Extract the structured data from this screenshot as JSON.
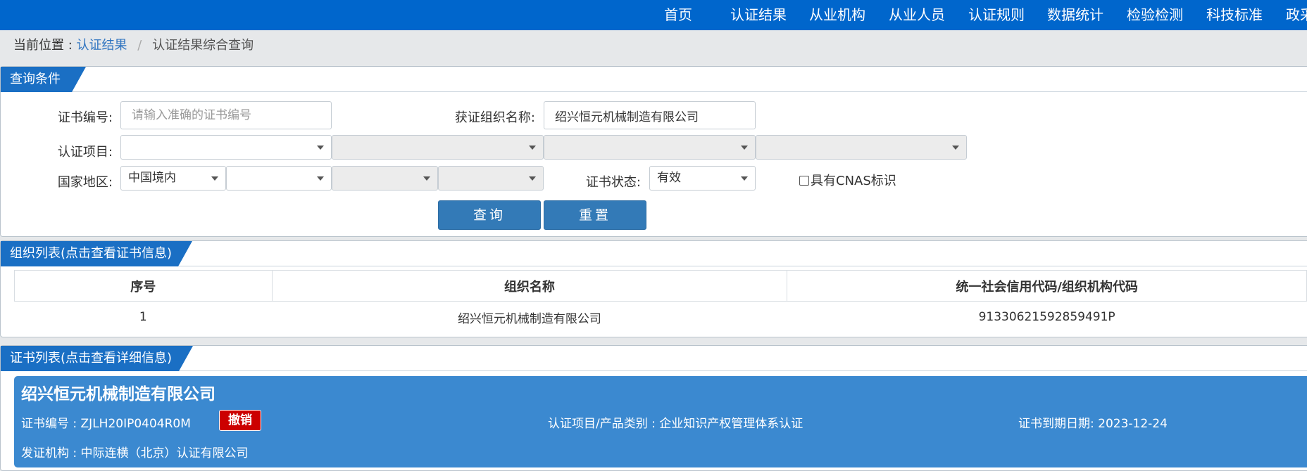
{
  "nav": {
    "items": [
      "首页",
      "认证结果",
      "从业机构",
      "从业人员",
      "认证规则",
      "数据统计",
      "检验检测",
      "科技标准",
      "政采"
    ]
  },
  "breadcrumb": {
    "prefix": "当前位置 :",
    "link": "认证结果",
    "separator": "/",
    "current": "认证结果综合查询"
  },
  "query": {
    "title": "查询条件",
    "cert_no_label": "证书编号:",
    "cert_no_placeholder": "请输入准确的证书编号",
    "cert_no_value": "",
    "org_name_label": "获证组织名称:",
    "org_name_value": "绍兴恒元机械制造有限公司",
    "project_label": "认证项目:",
    "project_selects": [
      "",
      "",
      "",
      ""
    ],
    "region_label": "国家地区:",
    "region_selects": [
      "中国境内",
      "",
      "",
      ""
    ],
    "status_label": "证书状态:",
    "status_value": "有效",
    "cnas_label": "具有CNAS标识",
    "search_button": "查询",
    "reset_button": "重置"
  },
  "org_list": {
    "title": "组织列表(点击查看证书信息)",
    "columns": [
      "序号",
      "组织名称",
      "统一社会信用代码/组织机构代码"
    ],
    "rows": [
      [
        "1",
        "绍兴恒元机械制造有限公司",
        "91330621592859491P"
      ]
    ]
  },
  "cert_list": {
    "title": "证书列表(点击查看详细信息)",
    "card": {
      "org_name": "绍兴恒元机械制造有限公司",
      "cert_no": "证书编号 : ZJLH20IP0404R0M",
      "status_badge": "撤销",
      "project": "认证项目/产品类别 : 企业知识产权管理体系认证",
      "expiry": "证书到期日期: 2023-12-24",
      "issuer": "发证机构 : 中际连横（北京）认证有限公司"
    }
  },
  "colors": {
    "nav_bg": "#0066cc",
    "button_bg": "#337ab7",
    "card_bg": "#3b89d0",
    "badge_red": "#cc0000"
  }
}
